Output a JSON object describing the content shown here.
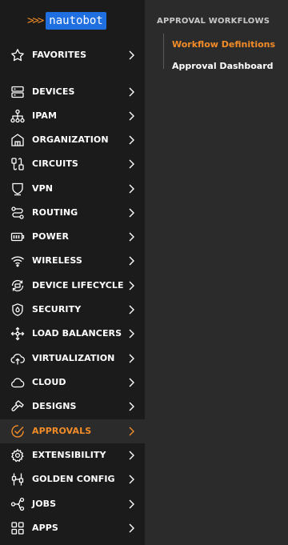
{
  "logo": {
    "chevrons": ">>>",
    "text": "nautobot"
  },
  "nav": {
    "items": [
      {
        "label": "FAVORITES",
        "icon": "star-icon"
      },
      {
        "label": "DEVICES",
        "icon": "server-icon"
      },
      {
        "label": "IPAM",
        "icon": "network-tree-icon"
      },
      {
        "label": "ORGANIZATION",
        "icon": "building-icon"
      },
      {
        "label": "CIRCUITS",
        "icon": "circuit-icon"
      },
      {
        "label": "VPN",
        "icon": "shield-icon"
      },
      {
        "label": "ROUTING",
        "icon": "route-icon"
      },
      {
        "label": "POWER",
        "icon": "battery-icon"
      },
      {
        "label": "WIRELESS",
        "icon": "wifi-icon"
      },
      {
        "label": "DEVICE LIFECYCLE",
        "icon": "lifecycle-icon"
      },
      {
        "label": "SECURITY",
        "icon": "security-shield-icon"
      },
      {
        "label": "LOAD BALANCERS",
        "icon": "load-balancer-icon"
      },
      {
        "label": "VIRTUALIZATION",
        "icon": "cloud-upload-icon"
      },
      {
        "label": "CLOUD",
        "icon": "cloud-icon"
      },
      {
        "label": "DESIGNS",
        "icon": "hammer-icon"
      },
      {
        "label": "APPROVALS",
        "icon": "check-circle-icon"
      },
      {
        "label": "EXTENSIBILITY",
        "icon": "gear-icon"
      },
      {
        "label": "GOLDEN CONFIG",
        "icon": "sliders-icon"
      },
      {
        "label": "JOBS",
        "icon": "jobs-icon"
      },
      {
        "label": "APPS",
        "icon": "apps-grid-icon"
      }
    ],
    "active": "APPROVALS"
  },
  "submenu": {
    "title": "APPROVAL WORKFLOWS",
    "links": [
      {
        "label": "Workflow Definitions",
        "active": true
      },
      {
        "label": "Approval Dashboard",
        "active": false
      }
    ]
  },
  "colors": {
    "accent": "#f28c28",
    "logo_blue": "#1f6fe0",
    "sidebar_bg": "#1b1b1b",
    "panel_bg": "#2b2b2b"
  }
}
